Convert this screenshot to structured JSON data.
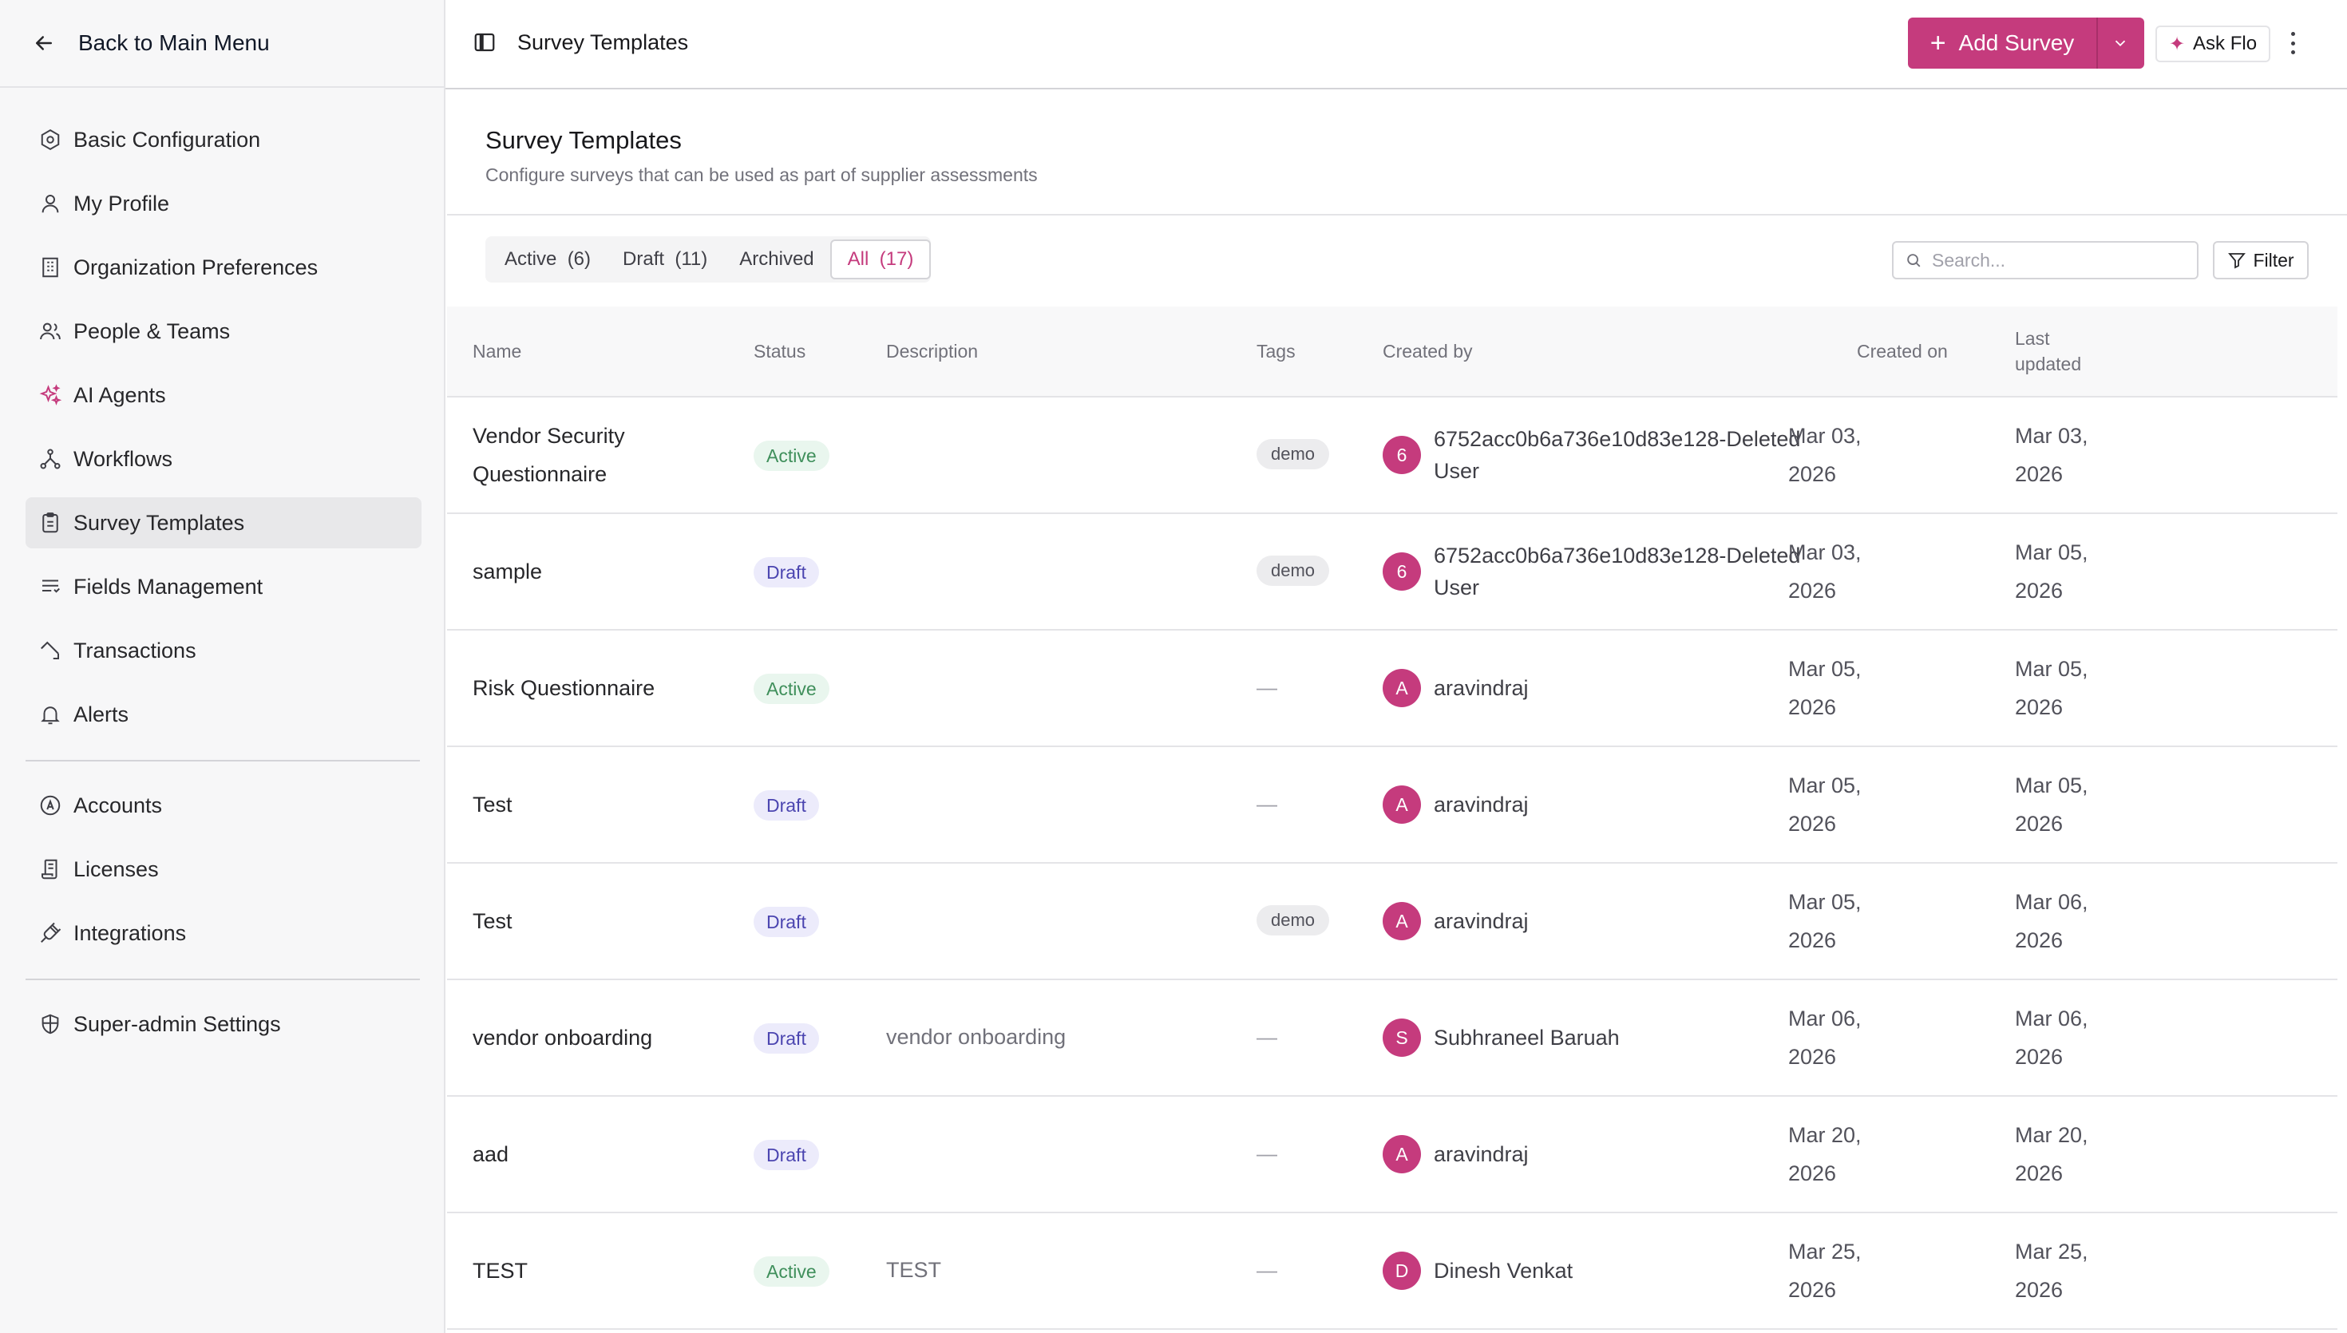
{
  "sidebar": {
    "back_label": "Back to Main Menu",
    "items": [
      {
        "label": "Basic Configuration",
        "icon": "settings-hex-icon"
      },
      {
        "label": "My Profile",
        "icon": "user-icon"
      },
      {
        "label": "Organization Preferences",
        "icon": "building-icon"
      },
      {
        "label": "People & Teams",
        "icon": "users-icon"
      },
      {
        "label": "AI Agents",
        "icon": "sparkles-icon"
      },
      {
        "label": "Workflows",
        "icon": "workflow-icon"
      },
      {
        "label": "Survey Templates",
        "icon": "clipboard-icon",
        "active": true
      },
      {
        "label": "Fields Management",
        "icon": "list-icon"
      },
      {
        "label": "Transactions",
        "icon": "arrows-icon"
      },
      {
        "label": "Alerts",
        "icon": "bell-icon"
      },
      {
        "label": "Accounts",
        "icon": "circle-a-icon"
      },
      {
        "label": "Licenses",
        "icon": "license-icon"
      },
      {
        "label": "Integrations",
        "icon": "plug-icon"
      },
      {
        "label": "Super-admin Settings",
        "icon": "shield-icon"
      }
    ]
  },
  "topbar": {
    "breadcrumb": "Survey Templates",
    "add_label": "Add Survey",
    "ask_label": "Ask Flo"
  },
  "header": {
    "title": "Survey Templates",
    "subtitle": "Configure surveys that can be used as part of supplier assessments"
  },
  "tabs": [
    {
      "label": "Active  (6)"
    },
    {
      "label": "Draft  (11)"
    },
    {
      "label": "Archived"
    },
    {
      "label": "All  (17)",
      "active": true
    }
  ],
  "search": {
    "placeholder": "Search..."
  },
  "filter_label": "Filter",
  "table": {
    "columns": {
      "name": "Name",
      "status": "Status",
      "description": "Description",
      "tags": "Tags",
      "created_by": "Created by",
      "created_on": "Created on",
      "last_updated_1": "Last",
      "last_updated_2": "updated"
    },
    "rows": [
      {
        "name_1": "Vendor Security",
        "name_2": "Questionnaire",
        "status": "Active",
        "description": "",
        "tag": "demo",
        "initial": "6",
        "creator_1": "6752acc0b6a736e10d83e128-Deleted",
        "creator_2": "User",
        "created_1": "Mar 03,",
        "created_2": "2026",
        "updated_1": "Mar 03,",
        "updated_2": "2026"
      },
      {
        "name_1": "sample",
        "name_2": "",
        "status": "Draft",
        "description": "",
        "tag": "demo",
        "initial": "6",
        "creator_1": "6752acc0b6a736e10d83e128-Deleted",
        "creator_2": "User",
        "created_1": "Mar 03,",
        "created_2": "2026",
        "updated_1": "Mar 05,",
        "updated_2": "2026"
      },
      {
        "name_1": "Risk Questionnaire",
        "name_2": "",
        "status": "Active",
        "description": "",
        "tag": "",
        "initial": "A",
        "creator_1": "aravindraj",
        "creator_2": "",
        "created_1": "Mar 05,",
        "created_2": "2026",
        "updated_1": "Mar 05,",
        "updated_2": "2026"
      },
      {
        "name_1": "Test",
        "name_2": "",
        "status": "Draft",
        "description": "",
        "tag": "",
        "initial": "A",
        "creator_1": "aravindraj",
        "creator_2": "",
        "created_1": "Mar 05,",
        "created_2": "2026",
        "updated_1": "Mar 05,",
        "updated_2": "2026"
      },
      {
        "name_1": "Test",
        "name_2": "",
        "status": "Draft",
        "description": "",
        "tag": "demo",
        "initial": "A",
        "creator_1": "aravindraj",
        "creator_2": "",
        "created_1": "Mar 05,",
        "created_2": "2026",
        "updated_1": "Mar 06,",
        "updated_2": "2026"
      },
      {
        "name_1": "vendor onboarding",
        "name_2": "",
        "status": "Draft",
        "description": "vendor onboarding",
        "tag": "",
        "initial": "S",
        "creator_1": "Subhraneel Baruah",
        "creator_2": "",
        "created_1": "Mar 06,",
        "created_2": "2026",
        "updated_1": "Mar 06,",
        "updated_2": "2026"
      },
      {
        "name_1": "aad",
        "name_2": "",
        "status": "Draft",
        "description": "",
        "tag": "",
        "initial": "A",
        "creator_1": "aravindraj",
        "creator_2": "",
        "created_1": "Mar 20,",
        "created_2": "2026",
        "updated_1": "Mar 20,",
        "updated_2": "2026"
      },
      {
        "name_1": "TEST",
        "name_2": "",
        "status": "Active",
        "description": "TEST",
        "tag": "",
        "initial": "D",
        "creator_1": "Dinesh Venkat",
        "creator_2": "",
        "created_1": "Mar 25,",
        "created_2": "2026",
        "updated_1": "Mar 25,",
        "updated_2": "2026"
      }
    ],
    "empty_tag": "—"
  },
  "colors": {
    "accent": "#c53b7d",
    "active_badge": "#3f8f5b",
    "draft_badge": "#4b45b0"
  }
}
